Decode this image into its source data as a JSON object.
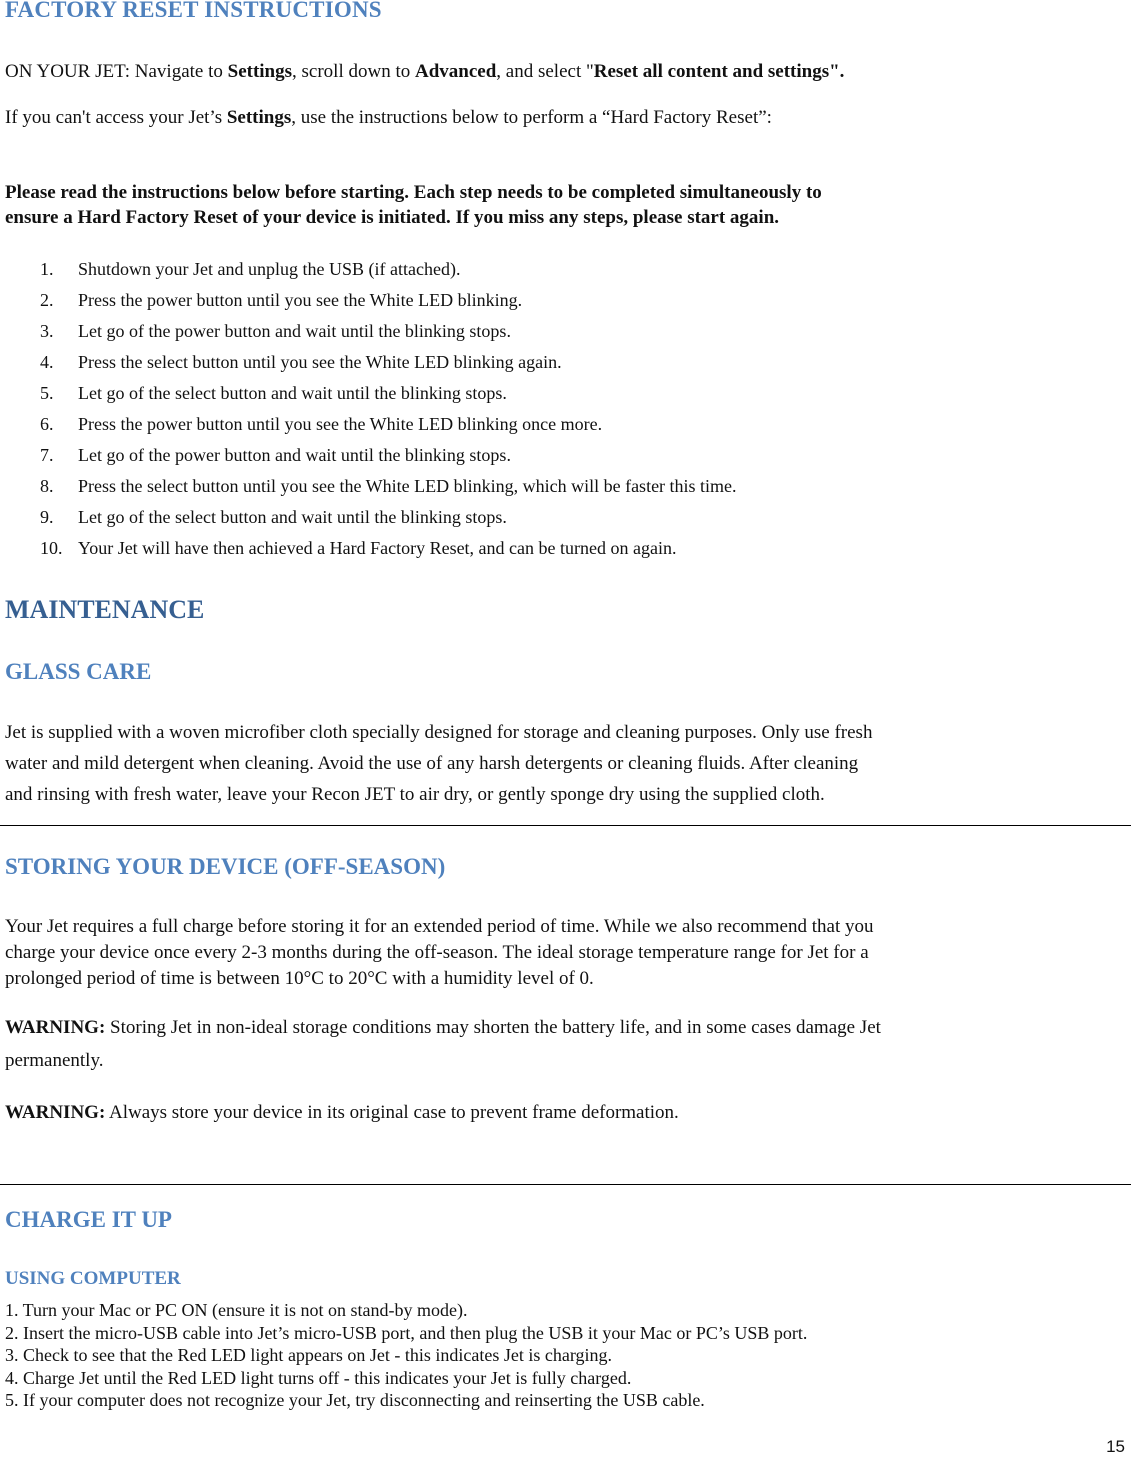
{
  "factory_reset": {
    "heading": "FACTORY RESET INSTRUCTIONS",
    "on_jet": {
      "prefix": "ON YOUR JET: Navigate to ",
      "settings": "Settings",
      "mid": ", scroll down to ",
      "advanced": "Advanced",
      "mid2": ", and select \"",
      "reset_option": "Reset all content and settings\".",
      "suffix": ""
    },
    "cant_access": {
      "prefix": "If you can't access your Jet’s ",
      "settings": "Settings",
      "suffix": ", use the instructions below to perform a “Hard Factory Reset”:"
    },
    "notice_line1": "Please read the instructions below before starting. Each step needs to be completed simultaneously to",
    "notice_line2": "ensure a Hard Factory Reset of your device is initiated. If you miss any steps, please start again.",
    "steps": [
      {
        "num": "1.",
        "text": "Shutdown your Jet and unplug the USB (if attached)."
      },
      {
        "num": "2.",
        "text": "Press the power button until you see the White LED blinking."
      },
      {
        "num": "3.",
        "text": "Let go of the power button and wait until the blinking stops."
      },
      {
        "num": "4.",
        "text": "Press the select button until you see the White LED blinking again."
      },
      {
        "num": "5.",
        "text": "Let go of the select button and wait until the blinking stops."
      },
      {
        "num": "6.",
        "text": "Press the power button until you see the White LED blinking once more."
      },
      {
        "num": "7.",
        "text": "Let go of the power button and wait until the blinking stops."
      },
      {
        "num": "8.",
        "text": "Press the select button until you see the White LED blinking, which will be faster this time."
      },
      {
        "num": "9.",
        "text": "Let go of the select button and wait until the blinking stops."
      },
      {
        "num": "10.",
        "text": "Your Jet will have then achieved a Hard Factory Reset, and can be turned on again."
      }
    ]
  },
  "maintenance": {
    "heading": "MAINTENANCE",
    "glass_care": {
      "heading": "GLASS CARE",
      "lines": [
        "Jet is supplied with a woven microfiber cloth specially designed for storage and cleaning purposes. Only use fresh",
        "water and mild detergent when cleaning. Avoid the use of any harsh detergents or cleaning fluids. After cleaning",
        "and rinsing with fresh water, leave your Recon JET to air dry, or gently sponge dry using the supplied cloth."
      ]
    },
    "storing": {
      "heading": "STORING YOUR DEVICE (OFF-SEASON)",
      "lines": [
        "Your Jet requires a full charge before storing it for an extended period of time. While we also recommend that you",
        "charge your device once every 2-3 months during the off-season.  The ideal storage temperature range for Jet for a",
        "prolonged period of time is between 10°C to 20°C with a humidity level of 0."
      ],
      "warning1": {
        "label": "WARNING:",
        "line1": " Storing Jet in non-ideal storage conditions may shorten the battery life, and in some cases damage Jet",
        "line2": "permanently."
      },
      "warning2": {
        "label": "WARNING:",
        "text": " Always store your device in its original case to prevent frame deformation."
      }
    }
  },
  "charge": {
    "heading": "CHARGE IT UP",
    "subheading": "USING COMPUTER",
    "steps": [
      "1. Turn your Mac or PC ON (ensure it is not on stand-by mode).",
      "2. Insert the micro-USB cable into Jet’s micro-USB port, and then plug the USB it your Mac or PC’s USB port.",
      "3. Check to see that the Red LED light appears on Jet - this indicates Jet is charging.",
      "4. Charge Jet until the Red LED light turns off - this indicates your Jet is fully charged.",
      "5. If your computer does not recognize your Jet, try disconnecting and reinserting the USB cable."
    ]
  },
  "page_number": "15"
}
